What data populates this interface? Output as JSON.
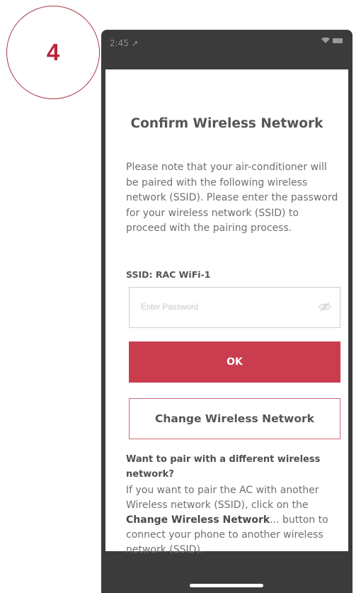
{
  "step": {
    "number": "4"
  },
  "status_bar": {
    "time": "2:45"
  },
  "dialog": {
    "title": "Confirm Wireless Network",
    "intro": "Please note that your air-conditioner will be paired with the following wireless network (SSID). Please enter the password for your wireless network (SSID) to proceed with the pairing process.",
    "ssid_label": "SSID: RAC WiFi-1",
    "password": {
      "value": "",
      "placeholder": "Enter Password"
    },
    "ok_label": "OK",
    "change_label": "Change Wireless Network",
    "different_title": "Want to pair with a different wireless network?",
    "different_body_pre": "If you want to pair the AC with another Wireless network (SSID), click on the ",
    "different_body_bold": "Change Wireless Network",
    "different_body_post": "... button to connect your phone to another wireless network (SSID)."
  },
  "colors": {
    "accent": "#c93d4f",
    "step_circle": "#a83a44",
    "frame": "#3b3b3b"
  }
}
